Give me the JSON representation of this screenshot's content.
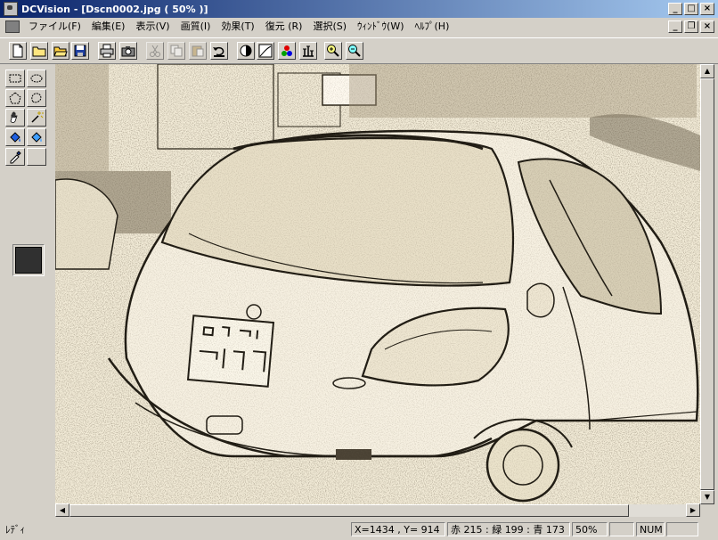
{
  "window": {
    "title": "DCVision - [Dscn0002.jpg ( 50% )]",
    "buttons": {
      "minimize": "_",
      "maximize": "□",
      "close": "×"
    }
  },
  "menu": {
    "items": [
      "ファイル(F)",
      "編集(E)",
      "表示(V)",
      "画質(I)",
      "効果(T)",
      "復元 (R)",
      "選択(S)",
      "ｳｨﾝﾄﾞｳ(W)",
      "ﾍﾙﾌﾟ(H)"
    ],
    "mdi_buttons": {
      "minimize": "_",
      "restore": "❐",
      "close": "×"
    }
  },
  "toolbar": {
    "buttons": [
      "new-icon",
      "open-icon",
      "open-folder-icon",
      "save-icon",
      "print-icon",
      "camera-icon",
      "cut-icon",
      "copy-icon",
      "paste-icon",
      "undo-icon",
      "contrast-icon",
      "curve-icon",
      "rgb-icon",
      "levels-icon",
      "zoom-in-icon",
      "zoom-out-icon"
    ]
  },
  "tools": [
    "rect-select-icon",
    "ellipse-select-icon",
    "polygon-select-icon",
    "lasso-icon",
    "hand-icon",
    "magic-wand-icon",
    "fill-blue-icon",
    "fill-cyan-icon",
    "eyedropper-icon"
  ],
  "colors": {
    "foreground": "#303030",
    "selection": "#0a246a",
    "title_grad_end": "#a6caf0"
  },
  "status": {
    "ready": "ﾚﾃﾞｨ",
    "coords": "X=1434 , Y= 914",
    "rgb": "赤 215 : 緑 199 : 青 173",
    "zoom": "50%",
    "num": "NUM"
  }
}
